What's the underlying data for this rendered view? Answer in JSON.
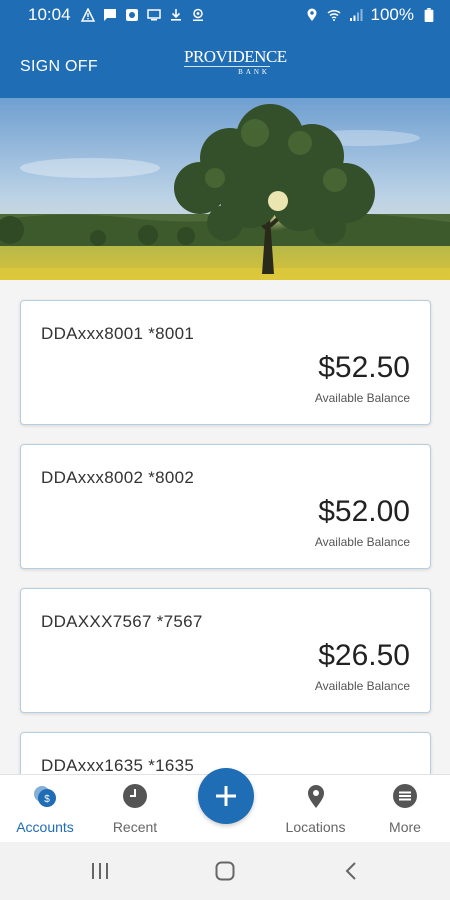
{
  "status_bar": {
    "time": "10:04",
    "battery": "100%"
  },
  "header": {
    "sign_off_label": "SIGN OFF",
    "logo_main": "PROVIDENCE",
    "logo_sub": "BANK"
  },
  "accounts": [
    {
      "name": "DDAxxx8001 *8001",
      "balance": "$52.50",
      "balance_label": "Available Balance"
    },
    {
      "name": "DDAxxx8002 *8002",
      "balance": "$52.00",
      "balance_label": "Available Balance"
    },
    {
      "name": "DDAXXX7567 *7567",
      "balance": "$26.50",
      "balance_label": "Available Balance"
    },
    {
      "name": "DDAxxx1635 *1635",
      "balance": "",
      "balance_label": ""
    }
  ],
  "bottom_nav": {
    "items": [
      {
        "label": "Accounts",
        "icon": "accounts-icon",
        "active": true
      },
      {
        "label": "Recent",
        "icon": "clock-icon",
        "active": false
      },
      {
        "label": "Locations",
        "icon": "location-pin-icon",
        "active": false
      },
      {
        "label": "More",
        "icon": "menu-icon",
        "active": false
      }
    ],
    "fab_icon": "plus-icon"
  },
  "colors": {
    "brand": "#1f6db5",
    "card_border": "#b7cde0",
    "nav_inactive": "#666666"
  }
}
